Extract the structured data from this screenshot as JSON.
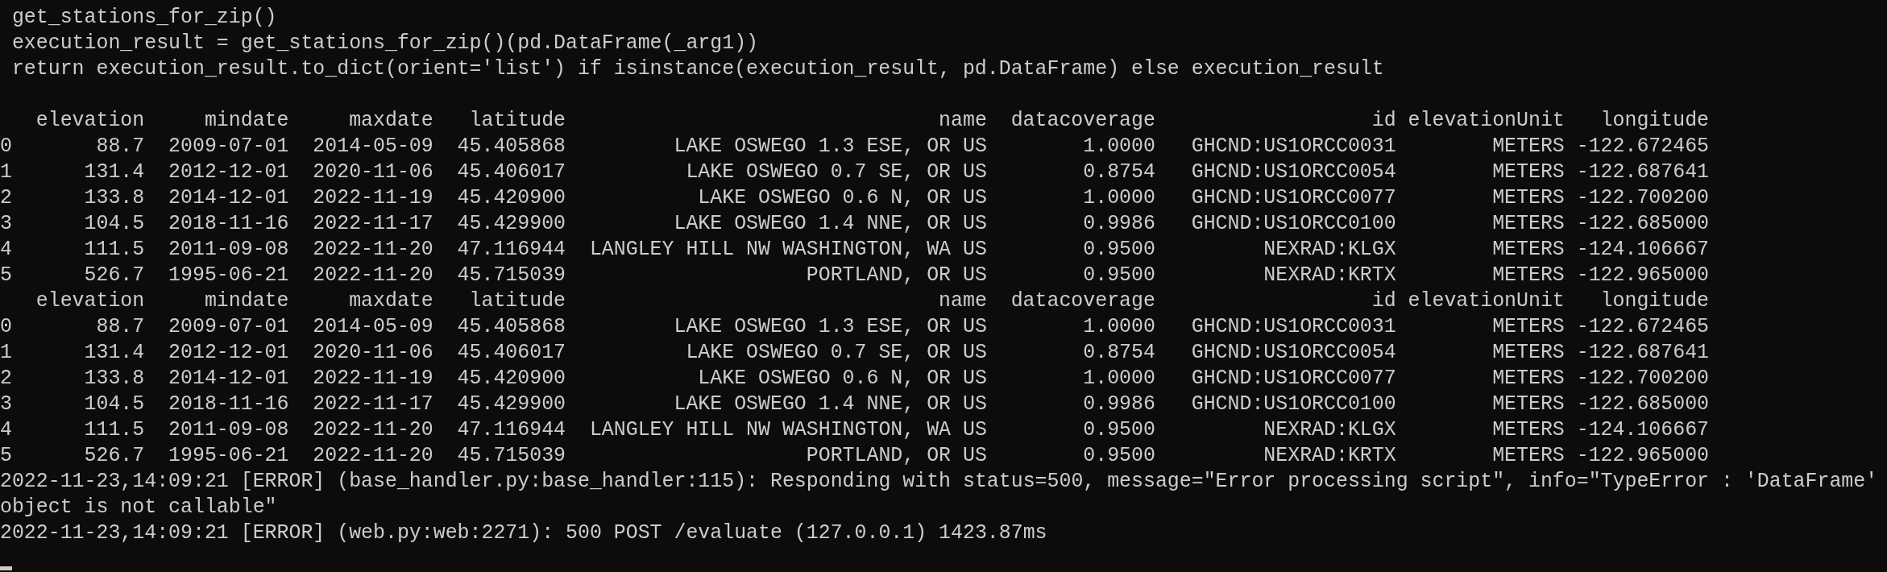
{
  "code_lines": [
    "get_stations_for_zip()",
    "execution_result = get_stations_for_zip()(pd.DataFrame(_arg1))",
    "return execution_result.to_dict(orient='list') if isinstance(execution_result, pd.DataFrame) else execution_result"
  ],
  "tables": [
    {
      "columns": [
        "elevation",
        "mindate",
        "maxdate",
        "latitude",
        "name",
        "datacoverage",
        "id",
        "elevationUnit",
        "longitude"
      ],
      "rows": [
        {
          "index": "0",
          "cells": [
            "88.7",
            "2009-07-01",
            "2014-05-09",
            "45.405868",
            "LAKE OSWEGO 1.3 ESE, OR US",
            "1.0000",
            "GHCND:US1ORCC0031",
            "METERS",
            "-122.672465"
          ]
        },
        {
          "index": "1",
          "cells": [
            "131.4",
            "2012-12-01",
            "2020-11-06",
            "45.406017",
            "LAKE OSWEGO 0.7 SE, OR US",
            "0.8754",
            "GHCND:US1ORCC0054",
            "METERS",
            "-122.687641"
          ]
        },
        {
          "index": "2",
          "cells": [
            "133.8",
            "2014-12-01",
            "2022-11-19",
            "45.420900",
            "LAKE OSWEGO 0.6 N, OR US",
            "1.0000",
            "GHCND:US1ORCC0077",
            "METERS",
            "-122.700200"
          ]
        },
        {
          "index": "3",
          "cells": [
            "104.5",
            "2018-11-16",
            "2022-11-17",
            "45.429900",
            "LAKE OSWEGO 1.4 NNE, OR US",
            "0.9986",
            "GHCND:US1ORCC0100",
            "METERS",
            "-122.685000"
          ]
        },
        {
          "index": "4",
          "cells": [
            "111.5",
            "2011-09-08",
            "2022-11-20",
            "47.116944",
            "LANGLEY HILL NW WASHINGTON, WA US",
            "0.9500",
            "NEXRAD:KLGX",
            "METERS",
            "-124.106667"
          ]
        },
        {
          "index": "5",
          "cells": [
            "526.7",
            "1995-06-21",
            "2022-11-20",
            "45.715039",
            "PORTLAND, OR US",
            "0.9500",
            "NEXRAD:KRTX",
            "METERS",
            "-122.965000"
          ]
        }
      ]
    },
    {
      "columns": [
        "elevation",
        "mindate",
        "maxdate",
        "latitude",
        "name",
        "datacoverage",
        "id",
        "elevationUnit",
        "longitude"
      ],
      "rows": [
        {
          "index": "0",
          "cells": [
            "88.7",
            "2009-07-01",
            "2014-05-09",
            "45.405868",
            "LAKE OSWEGO 1.3 ESE, OR US",
            "1.0000",
            "GHCND:US1ORCC0031",
            "METERS",
            "-122.672465"
          ]
        },
        {
          "index": "1",
          "cells": [
            "131.4",
            "2012-12-01",
            "2020-11-06",
            "45.406017",
            "LAKE OSWEGO 0.7 SE, OR US",
            "0.8754",
            "GHCND:US1ORCC0054",
            "METERS",
            "-122.687641"
          ]
        },
        {
          "index": "2",
          "cells": [
            "133.8",
            "2014-12-01",
            "2022-11-19",
            "45.420900",
            "LAKE OSWEGO 0.6 N, OR US",
            "1.0000",
            "GHCND:US1ORCC0077",
            "METERS",
            "-122.700200"
          ]
        },
        {
          "index": "3",
          "cells": [
            "104.5",
            "2018-11-16",
            "2022-11-17",
            "45.429900",
            "LAKE OSWEGO 1.4 NNE, OR US",
            "0.9986",
            "GHCND:US1ORCC0100",
            "METERS",
            "-122.685000"
          ]
        },
        {
          "index": "4",
          "cells": [
            "111.5",
            "2011-09-08",
            "2022-11-20",
            "47.116944",
            "LANGLEY HILL NW WASHINGTON, WA US",
            "0.9500",
            "NEXRAD:KLGX",
            "METERS",
            "-124.106667"
          ]
        },
        {
          "index": "5",
          "cells": [
            "526.7",
            "1995-06-21",
            "2022-11-20",
            "45.715039",
            "PORTLAND, OR US",
            "0.9500",
            "NEXRAD:KRTX",
            "METERS",
            "-122.965000"
          ]
        }
      ]
    }
  ],
  "log_lines": [
    "2022-11-23,14:09:21 [ERROR] (base_handler.py:base_handler:115): Responding with status=500, message=\"Error processing script\", info=\"TypeError : 'DataFrame' object is not callable\"",
    "2022-11-23,14:09:21 [ERROR] (web.py:web:2271): 500 POST /evaluate (127.0.0.1) 1423.87ms"
  ]
}
